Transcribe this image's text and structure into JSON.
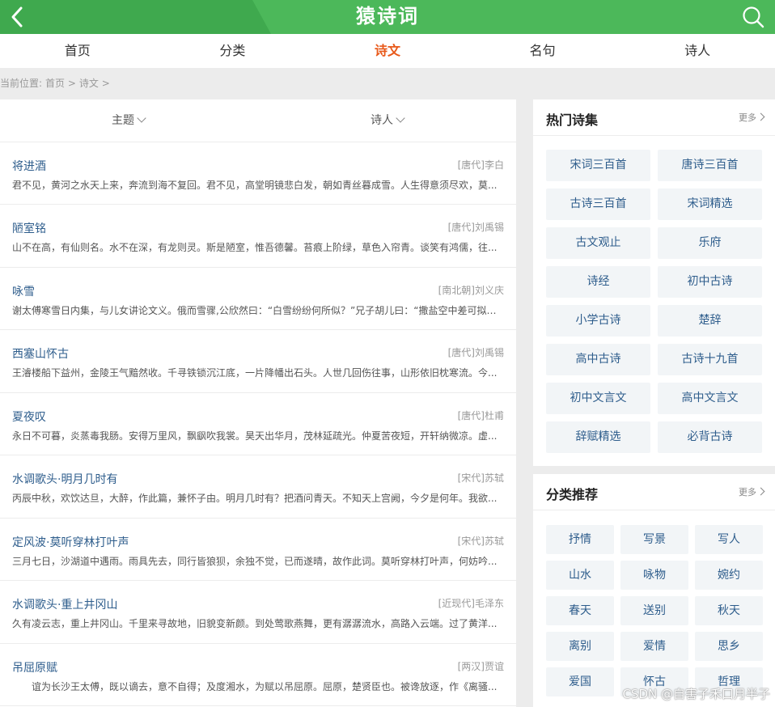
{
  "header": {
    "title": "猿诗词"
  },
  "nav": [
    {
      "label": "首页",
      "active": false
    },
    {
      "label": "分类",
      "active": false
    },
    {
      "label": "诗文",
      "active": true
    },
    {
      "label": "名句",
      "active": false
    },
    {
      "label": "诗人",
      "active": false
    }
  ],
  "breadcrumb": {
    "prefix": "当前位置:",
    "home": "首页 >",
    "current": "诗文 >"
  },
  "filters": {
    "theme": "主题",
    "poet": "诗人"
  },
  "poems": [
    {
      "title": "将进酒",
      "author": "[唐代]李白",
      "excerpt": "君不见，黄河之水天上来，奔流到海不复回。君不见，高堂明镜悲白发，朝如青丝暮成雪。人生得意须尽欢，莫..."
    },
    {
      "title": "陋室铭",
      "author": "[唐代]刘禹锡",
      "excerpt": "山不在高，有仙则名。水不在深，有龙则灵。斯是陋室，惟吾德馨。苔痕上阶绿，草色入帘青。谈笑有鸿儒，往..."
    },
    {
      "title": "咏雪",
      "author": "[南北朝]刘义庆",
      "excerpt": "谢太傅寒雪日内集，与儿女讲论文义。俄而雪骤,公欣然曰：“白雪纷纷何所似？”兄子胡儿曰：“撒盐空中差可拟。..."
    },
    {
      "title": "西塞山怀古",
      "author": "[唐代]刘禹锡",
      "excerpt": "王濬楼船下益州，金陵王气黯然收。千寻铁锁沉江底，一片降幡出石头。人世几回伤往事，山形依旧枕寒流。今..."
    },
    {
      "title": "夏夜叹",
      "author": "[唐代]杜甫",
      "excerpt": "永日不可暮，炎蒸毒我肠。安得万里风，飘飖吹我裳。昊天出华月，茂林延疏光。仲夏苦夜短，开轩纳微凉。虚..."
    },
    {
      "title": "水调歌头·明月几时有",
      "author": "[宋代]苏轼",
      "excerpt": "丙辰中秋，欢饮达旦，大醉，作此篇，兼怀子由。明月几时有？把酒问青天。不知天上宫阙，今夕是何年。我欲..."
    },
    {
      "title": "定风波·莫听穿林打叶声",
      "author": "[宋代]苏轼",
      "excerpt": "三月七日，沙湖道中遇雨。雨具先去，同行皆狼狈，余独不觉，已而遂晴，故作此词。莫听穿林打叶声，何妨吟..."
    },
    {
      "title": "水调歌头·重上井冈山",
      "author": "[近现代]毛泽东",
      "excerpt": "久有凌云志，重上井冈山。千里来寻故地，旧貌变新颜。到处莺歌燕舞，更有潺潺流水，高路入云端。过了黄洋..."
    },
    {
      "title": "吊屈原赋",
      "author": "[两汉]贾谊",
      "excerpt": "谊为长沙王太傅，既以谪去，意不自得；及度湘水，为赋以吊屈原。屈原，楚贤臣也。被谗放逐，作《离骚..."
    }
  ],
  "hot_collections": {
    "title": "热门诗集",
    "more": "更多",
    "items": [
      "宋词三百首",
      "唐诗三百首",
      "古诗三百首",
      "宋词精选",
      "古文观止",
      "乐府",
      "诗经",
      "初中古诗",
      "小学古诗",
      "楚辞",
      "高中古诗",
      "古诗十九首",
      "初中文言文",
      "高中文言文",
      "辞赋精选",
      "必背古诗"
    ]
  },
  "category_recommend": {
    "title": "分类推荐",
    "more": "更多",
    "items": [
      "抒情",
      "写景",
      "写人",
      "山水",
      "咏物",
      "婉约",
      "春天",
      "送别",
      "秋天",
      "离别",
      "爱情",
      "思乡",
      "爱国",
      "怀古",
      "哲理"
    ]
  },
  "watermark": "CSDN @自害子禾口月半子"
}
